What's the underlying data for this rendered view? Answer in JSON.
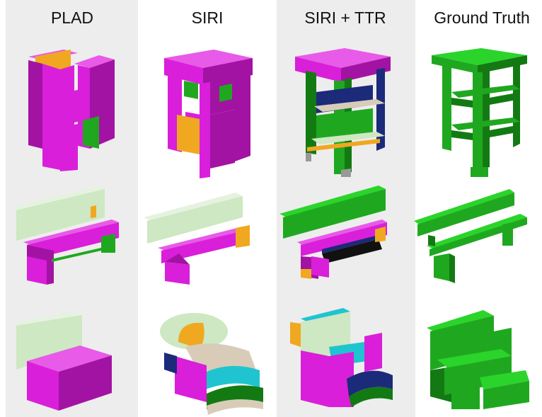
{
  "columns": [
    {
      "title": "PLAD"
    },
    {
      "title": "SIRI"
    },
    {
      "title": "SIRI + TTR"
    },
    {
      "title": "Ground Truth"
    }
  ],
  "rows": [
    "table/stand",
    "bench",
    "armchair"
  ],
  "colors": {
    "magenta": "#d91fd9",
    "magenta_dark": "#a313a3",
    "magenta_top": "#e85ae8",
    "green": "#1fa81f",
    "green_dark": "#137a13",
    "green_light": "#2bd42b",
    "pale_green": "#cde8c2",
    "orange": "#f0a820",
    "navy": "#1c2a7a",
    "cyan": "#20c4d0",
    "tan": "#d8ccb8",
    "column_shade": "#ededed"
  }
}
